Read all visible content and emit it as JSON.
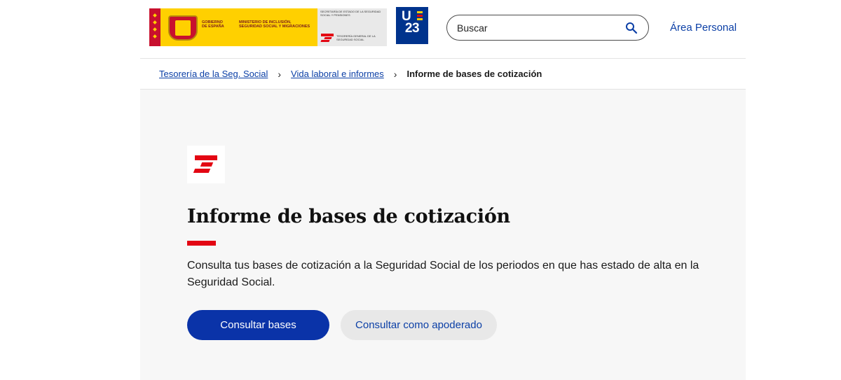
{
  "header": {
    "gov_logo": {
      "line1": "GOBIERNO",
      "line2": "DE ESPAÑA",
      "ministry": "MINISTERIO DE INCLUSIÓN, SEGURIDAD SOCIAL Y MIGRACIONES",
      "secretaria": "SECRETARÍA DE ESTADO DE LA SEGURIDAD SOCIAL Y PENSIONES",
      "tgss": "TESORERÍA GENERAL DE LA SEGURIDAD SOCIAL"
    },
    "ue23": {
      "top": "U",
      "bottom": "23"
    },
    "search": {
      "placeholder": "Buscar"
    },
    "area_personal": "Área Personal"
  },
  "breadcrumb": {
    "items": [
      {
        "label": "Tesorería de la Seg. Social"
      },
      {
        "label": "Vida laboral e informes"
      }
    ],
    "separator": "›",
    "current": "Informe de bases de cotización"
  },
  "main": {
    "title": "Informe de bases de cotización",
    "description": "Consulta tus bases de cotización a la Seguridad Social de los periodos en que has estado de alta en la Seguridad Social.",
    "primary_button": "Consultar bases",
    "secondary_button": "Consultar como apoderado"
  },
  "colors": {
    "accent_blue": "#0a33a8",
    "link_blue": "#0b3fa6",
    "brand_red": "#e30613",
    "panel_bg": "#f7f7f7",
    "ue_blue": "#00338d"
  },
  "icons": [
    "coat-of-arms-icon",
    "eu-flag-icon",
    "tgss-logo-icon",
    "search-icon",
    "chevron-right-icon"
  ]
}
